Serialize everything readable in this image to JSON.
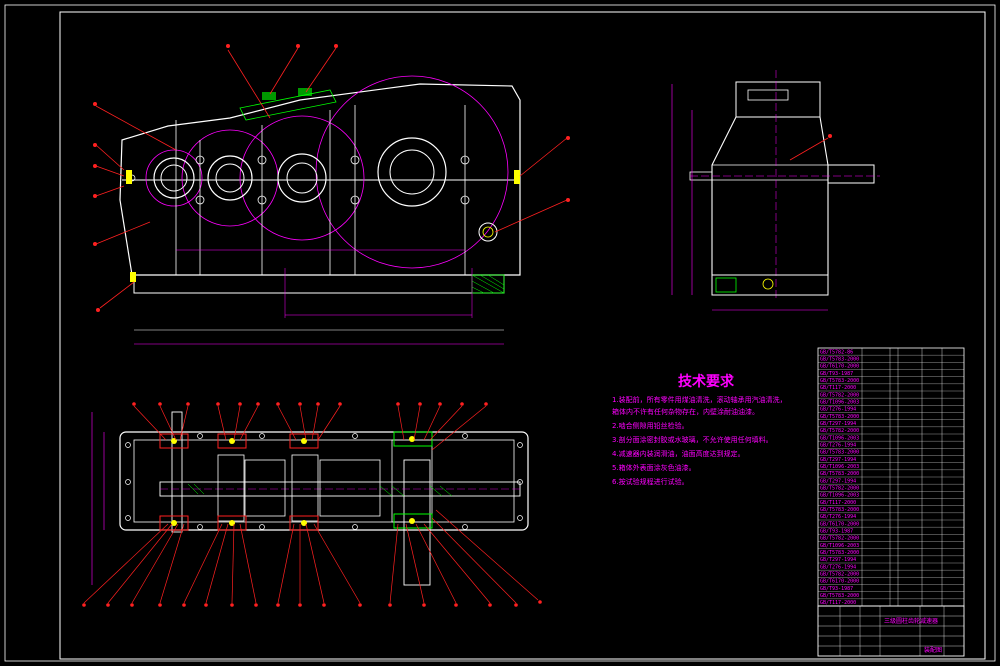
{
  "drawing": {
    "tech_requirements": {
      "title": "技术要求",
      "lines": [
        "1.装配前，所有零件用煤油清洗，滚动轴承用汽油清洗，",
        "  箱体内不许有任何杂物存在，内壁涂耐油油漆。",
        "2.啮合侧隙用铅丝检验。",
        "3.剖分面涂密封胶或水玻璃，不允许使用任何填料。",
        "4.减速器内装润滑油，油面高度达到规定。",
        "5.箱体外表面涂灰色油漆。",
        "6.按试验规程进行试验。"
      ]
    },
    "bom_rows": [
      "GB/T5782-86",
      "GB/T5783-2000",
      "GB/T6170-2000",
      "GB/T93-1987",
      "GB/T5783-2000",
      "GB/T117-2000",
      "GB/T5782-2000",
      "GB/T1096-2003",
      "GB/T276-1994",
      "GB/T5783-2000",
      "GB/T297-1994",
      "GB/T5782-2000",
      "GB/T1096-2003",
      "GB/T276-1994",
      "GB/T5783-2000",
      "GB/T297-1994",
      "GB/T1096-2003",
      "GB/T5783-2000",
      "GB/T297-1994",
      "GB/T5782-2000",
      "GB/T1096-2003",
      "GB/T117-2000",
      "GB/T5783-2000",
      "GB/T276-1994",
      "GB/T6170-2000",
      "GB/T93-1987",
      "GB/T5782-2000",
      "GB/T1096-2003",
      "GB/T5783-2000",
      "GB/T297-1994",
      "GB/T276-1994",
      "GB/T5782-2000",
      "GB/T6170-2000",
      "GB/T93-1987",
      "GB/T5783-2000",
      "GB/T117-2000"
    ],
    "title_block": {
      "name": "三级圆柱齿轮减速器",
      "drawing_no": "装配图"
    }
  }
}
